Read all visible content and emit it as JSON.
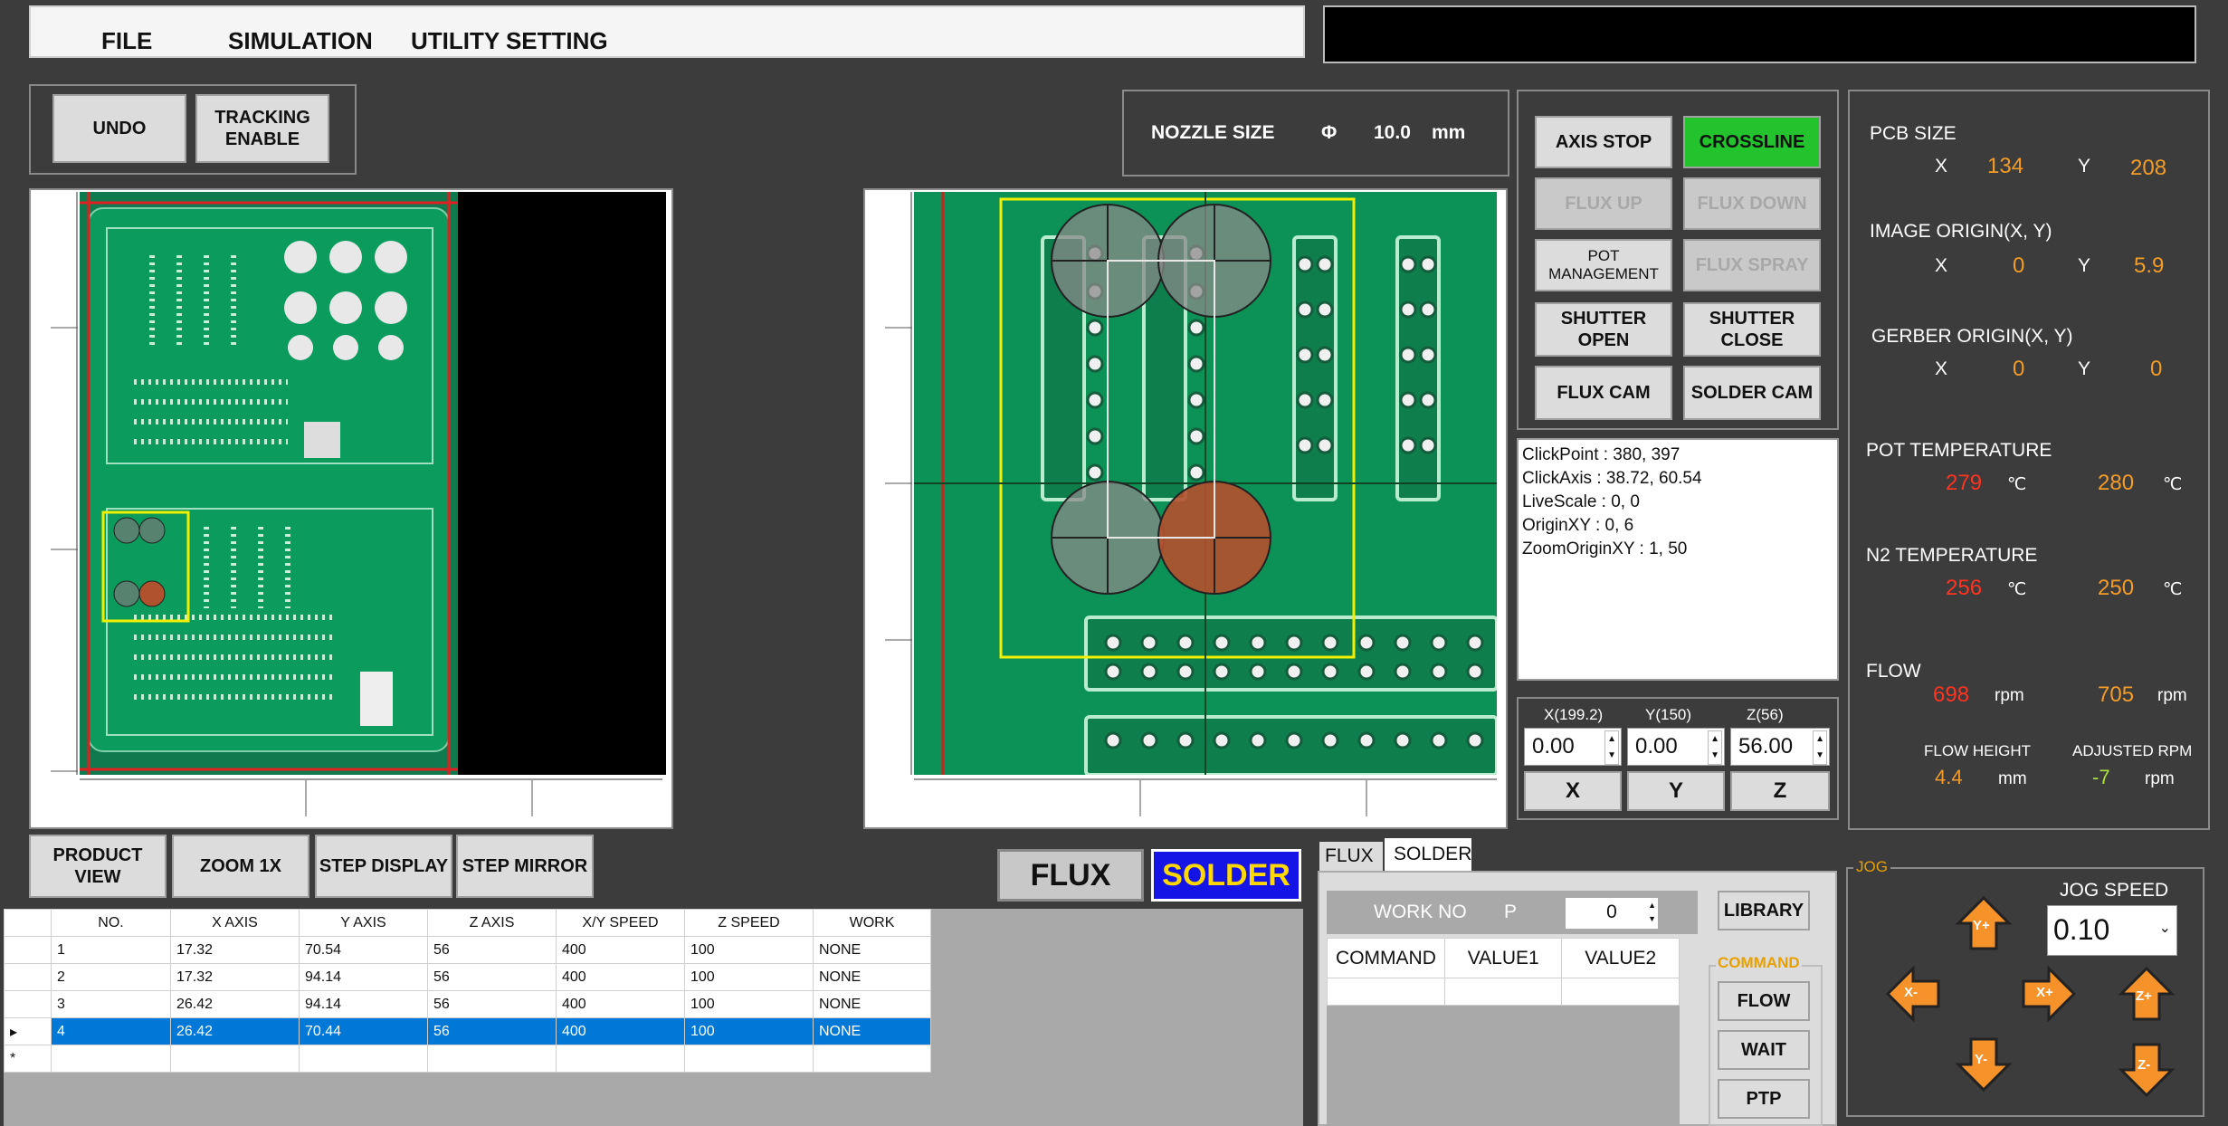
{
  "menu": {
    "items": [
      "FILE",
      "SIMULATION",
      "UTILITY SETTING"
    ]
  },
  "toolbar": {
    "undo": "UNDO",
    "tracking": "TRACKING\nENABLE"
  },
  "nozzle": {
    "label": "NOZZLE SIZE",
    "symbol": "Φ",
    "value": "10.0",
    "unit": "mm"
  },
  "controls": {
    "axis_stop": "AXIS STOP",
    "crossline": "CROSSLINE",
    "flux_up": "FLUX UP",
    "flux_down": "FLUX DOWN",
    "pot_management": "POT\nMANAGEMENT",
    "flux_spray": "FLUX SPRAY",
    "shutter_open": "SHUTTER\nOPEN",
    "shutter_close": "SHUTTER\nCLOSE",
    "flux_cam": "FLUX  CAM",
    "solder_cam": "SOLDER CAM"
  },
  "info_lines": [
    "ClickPoint : 380, 397",
    "ClickAxis : 38.72, 60.54",
    "LiveScale : 0, 0",
    "OriginXY : 0, 6",
    "ZoomOriginXY : 1, 50"
  ],
  "status": {
    "pcb_size": {
      "label": "PCB SIZE",
      "x_label": "X",
      "x": "134",
      "y_label": "Y",
      "y": "208"
    },
    "image_origin": {
      "label": "IMAGE ORIGIN(X, Y)",
      "x_label": "X",
      "x": "0",
      "y_label": "Y",
      "y": "5.9"
    },
    "gerber_origin": {
      "label": "GERBER ORIGIN(X, Y)",
      "x_label": "X",
      "x": "0",
      "y_label": "Y",
      "y": "0"
    },
    "pot_temp": {
      "label": "POT TEMPERATURE",
      "actual": "279",
      "set": "280",
      "unit": "℃"
    },
    "n2_temp": {
      "label": "N2 TEMPERATURE",
      "actual": "256",
      "set": "250",
      "unit": "℃"
    },
    "flow": {
      "label": "FLOW",
      "actual": "698",
      "set": "705",
      "unit": "rpm"
    },
    "flow_height": {
      "label": "FLOW HEIGHT",
      "value": "4.4",
      "unit": "mm"
    },
    "adjusted_rpm": {
      "label": "ADJUSTED RPM",
      "value": "-7",
      "unit": "rpm"
    }
  },
  "axes": {
    "x": {
      "label": "X(199.2)",
      "value": "0.00",
      "button": "X"
    },
    "y": {
      "label": "Y(150)",
      "value": "0.00",
      "button": "Y"
    },
    "z": {
      "label": "Z(56)",
      "value": "56.00",
      "button": "Z"
    }
  },
  "view_buttons": {
    "product_view": "PRODUCT\nVIEW",
    "zoom": "ZOOM 1X",
    "step_display": "STEP DISPLAY",
    "step_mirror": "STEP MIRROR"
  },
  "mode": {
    "flux": "FLUX",
    "solder": "SOLDER"
  },
  "table": {
    "headers": [
      "NO.",
      "X AXIS",
      "Y AXIS",
      "Z AXIS",
      "X/Y SPEED",
      "Z SPEED",
      "WORK"
    ],
    "rows": [
      [
        "1",
        "17.32",
        "70.54",
        "56",
        "400",
        "100",
        "NONE"
      ],
      [
        "2",
        "17.32",
        "94.14",
        "56",
        "400",
        "100",
        "NONE"
      ],
      [
        "3",
        "26.42",
        "94.14",
        "56",
        "400",
        "100",
        "NONE"
      ],
      [
        "4",
        "26.42",
        "70.44",
        "56",
        "400",
        "100",
        "NONE"
      ]
    ],
    "selected_index": 3
  },
  "work": {
    "tabs": [
      "FLUX",
      "SOLDER"
    ],
    "active_tab": "SOLDER",
    "work_no_label": "WORK NO",
    "p_label": "P",
    "p_value": "0",
    "columns": [
      "COMMAND",
      "VALUE1",
      "VALUE2"
    ]
  },
  "command": {
    "title": "COMMAND",
    "library": "LIBRARY",
    "flow": "FLOW",
    "wait": "WAIT",
    "ptp": "PTP"
  },
  "jog": {
    "title": "JOG",
    "speed_label": "JOG SPEED",
    "speed_value": "0.10",
    "up": "Y+",
    "down": "Y-",
    "left": "X-",
    "right": "X+",
    "z_up": "Z+",
    "z_down": "Z-"
  },
  "colors": {
    "background": "#3c3c3c",
    "accent_orange": "#f39c28",
    "alarm_red": "#ff3322",
    "crossline_green": "#22c32c",
    "solder_blue": "#1414e6",
    "selection": "#0078d7"
  }
}
